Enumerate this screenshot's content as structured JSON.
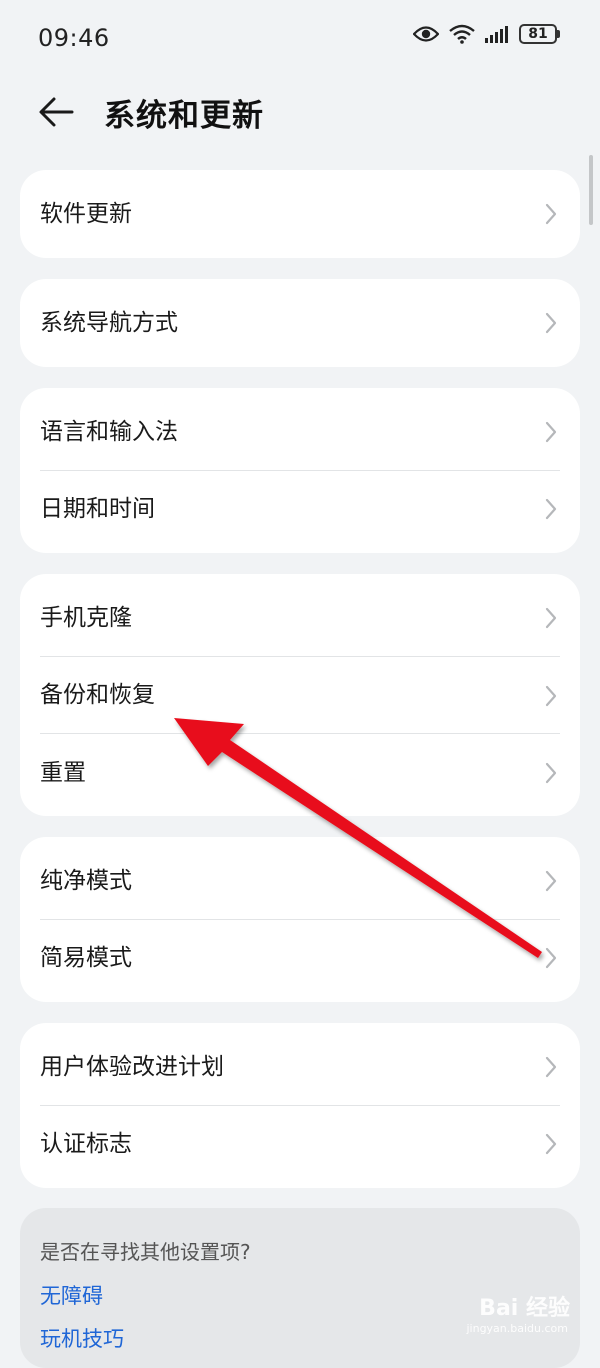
{
  "status_bar": {
    "time": "09:46",
    "battery": "81"
  },
  "header": {
    "title": "系统和更新"
  },
  "groups": [
    {
      "items": [
        {
          "label": "软件更新"
        }
      ]
    },
    {
      "items": [
        {
          "label": "系统导航方式"
        }
      ]
    },
    {
      "items": [
        {
          "label": "语言和输入法"
        },
        {
          "label": "日期和时间"
        }
      ]
    },
    {
      "items": [
        {
          "label": "手机克隆"
        },
        {
          "label": "备份和恢复"
        },
        {
          "label": "重置"
        }
      ]
    },
    {
      "items": [
        {
          "label": "纯净模式"
        },
        {
          "label": "简易模式"
        }
      ]
    },
    {
      "items": [
        {
          "label": "用户体验改进计划"
        },
        {
          "label": "认证标志"
        }
      ]
    }
  ],
  "suggestion": {
    "question": "是否在寻找其他设置项?",
    "links": [
      {
        "label": "无障碍"
      },
      {
        "label": "玩机技巧"
      }
    ]
  },
  "watermark": {
    "text": "Bai 经验",
    "sub": "jingyan.baidu.com"
  },
  "colors": {
    "background": "#f1f3f5",
    "card": "#ffffff",
    "link": "#1f66d6",
    "annotation_arrow": "#e8101a"
  }
}
